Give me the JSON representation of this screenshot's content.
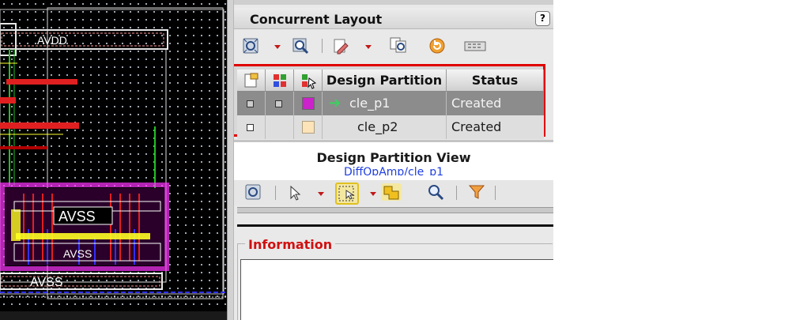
{
  "canvas": {
    "labels": {
      "avdd": "AVDD",
      "avss_top": "AVSS",
      "avss_mid": "AVSS",
      "avss_bottom": "AVSS"
    }
  },
  "panel": {
    "title": "Concurrent Layout",
    "help_label": "?",
    "toolbar_icons": [
      "zoom-fit-icon",
      "zoom-select-icon",
      "edit-partition-icon",
      "compare-icon",
      "undo-icon",
      "grid-options-icon"
    ],
    "table": {
      "columns": [
        "",
        "",
        "",
        "Design Partition",
        "Status"
      ],
      "column_icons": [
        "partition-props-icon",
        "layer-palette-icon",
        "select-color-icon"
      ],
      "rows": [
        {
          "name": "cle_p1",
          "status": "Created",
          "color": "#cc22cc",
          "active": true,
          "selected": true
        },
        {
          "name": "cle_p2",
          "status": "Created",
          "color": "#fde3b8",
          "active": false,
          "selected": false
        }
      ],
      "highlight_color": "#e00000"
    },
    "design_partition_view": {
      "heading": "Design Partition View",
      "path": "DiffOpAmp/cle_p1"
    },
    "view_toolbar_icons": [
      "zoom-fit-icon",
      "pointer-icon",
      "select-rect-icon",
      "polygon-icon",
      "search-icon",
      "filter-icon"
    ],
    "information": {
      "label": "Information",
      "text": ""
    }
  },
  "colors": {
    "accent_red": "#e00000",
    "link_blue": "#1f3fe0",
    "magenta": "#cc22cc"
  }
}
